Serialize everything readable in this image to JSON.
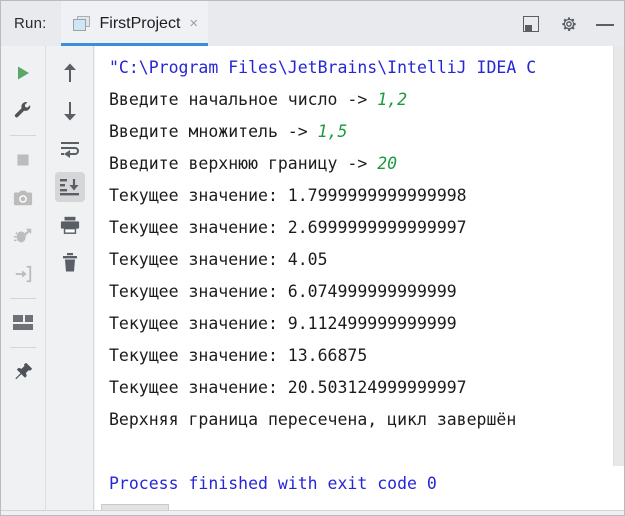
{
  "window": {
    "run_label": "Run:",
    "tab": {
      "title": "FirstProject",
      "close": "×",
      "icon": "console-window-icon"
    },
    "header_buttons": [
      {
        "name": "hide-panel-button",
        "label": "Hide"
      },
      {
        "name": "settings-button",
        "label": "Settings"
      },
      {
        "name": "minimize-button",
        "label": "Minimize"
      }
    ],
    "accent_color": "#3c8ddb"
  },
  "toolbar_left": [
    {
      "name": "rerun-button",
      "icon": "play-icon",
      "color": "#59a869",
      "enabled": true
    },
    {
      "name": "edit-configurations-button",
      "icon": "wrench-icon",
      "color": "#5a5f65",
      "enabled": true
    },
    {
      "name": "separator-1",
      "icon": "separator",
      "color": "",
      "enabled": false
    },
    {
      "name": "stop-button",
      "icon": "stop-square-icon",
      "color": "#bcbcbc",
      "enabled": false
    },
    {
      "name": "screenshot-button",
      "icon": "camera-icon",
      "color": "#bcbcbc",
      "enabled": false
    },
    {
      "name": "restore-layout-button",
      "icon": "bug-restore-icon",
      "color": "#bcbcbc",
      "enabled": false
    },
    {
      "name": "thread-dump-button",
      "icon": "export-arrow-icon",
      "color": "#bcbcbc",
      "enabled": false
    },
    {
      "name": "separator-2",
      "icon": "separator",
      "color": "",
      "enabled": false
    },
    {
      "name": "layout-settings-button",
      "icon": "layout-icon",
      "color": "#6e7276",
      "enabled": true
    },
    {
      "name": "separator-3",
      "icon": "separator",
      "color": "",
      "enabled": false
    },
    {
      "name": "pin-tab-button",
      "icon": "pin-icon",
      "color": "#5a5f65",
      "enabled": true
    }
  ],
  "toolbar_mid": [
    {
      "name": "up-the-stack-trace-button",
      "icon": "arrow-up-icon",
      "selected": false
    },
    {
      "name": "down-the-stack-trace-button",
      "icon": "arrow-down-icon",
      "selected": false
    },
    {
      "name": "soft-wrap-button",
      "icon": "soft-wrap-icon",
      "selected": false
    },
    {
      "name": "scroll-to-end-button",
      "icon": "scroll-to-end-icon",
      "selected": true
    },
    {
      "name": "print-button",
      "icon": "print-icon",
      "selected": false
    },
    {
      "name": "clear-all-button",
      "icon": "trash-icon",
      "selected": false
    }
  ],
  "console": {
    "lines": [
      {
        "text": "\"C:\\Program Files\\JetBrains\\IntelliJ IDEA C",
        "style": "blue"
      },
      {
        "text": "Введите начальное число -> ",
        "style": "black",
        "suffix": "1,2",
        "suffix_style": "green"
      },
      {
        "text": "Введите множитель -> ",
        "style": "black",
        "suffix": "1,5",
        "suffix_style": "green"
      },
      {
        "text": "Введите верхнюю границу -> ",
        "style": "black",
        "suffix": "20",
        "suffix_style": "green"
      },
      {
        "text": "Текущее значение: 1.7999999999999998",
        "style": "black"
      },
      {
        "text": "Текущее значение: 2.6999999999999997",
        "style": "black"
      },
      {
        "text": "Текущее значение: 4.05",
        "style": "black"
      },
      {
        "text": "Текущее значение: 6.074999999999999",
        "style": "black"
      },
      {
        "text": "Текущее значение: 9.112499999999999",
        "style": "black"
      },
      {
        "text": "Текущее значение: 13.66875",
        "style": "black"
      },
      {
        "text": "Текущее значение: 20.503124999999997",
        "style": "black"
      },
      {
        "text": "Верхняя граница пересечена, цикл завершён",
        "style": "black"
      },
      {
        "text": "",
        "style": "black"
      },
      {
        "text": "Process finished with exit code 0",
        "style": "blue"
      }
    ],
    "colors": {
      "output": "#1c1c1c",
      "system": "#2626d8",
      "user_input": "#1a9b3c",
      "background": "#ffffff"
    }
  }
}
